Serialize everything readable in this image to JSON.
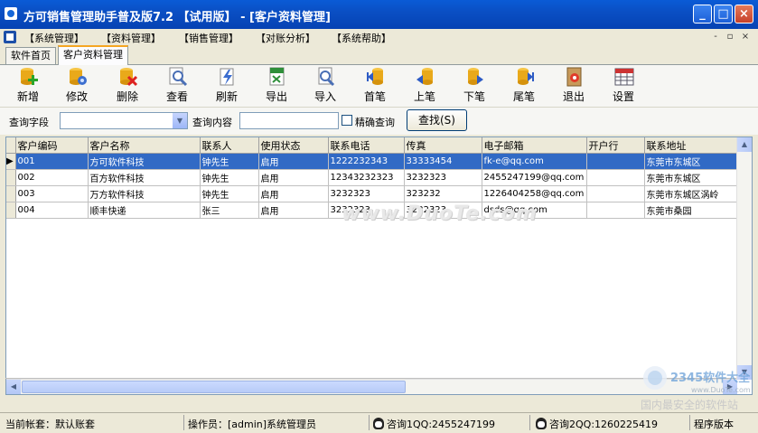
{
  "window": {
    "title": "方可销售管理助手普及版7.2 【试用版】 - [客户资料管理]",
    "controls": [
      "_",
      "□",
      "×"
    ]
  },
  "menu": [
    "【系统管理】",
    "【资料管理】",
    "【销售管理】",
    "【对账分析】",
    "【系统帮助】"
  ],
  "mdi_controls": [
    "-",
    "▫",
    "×"
  ],
  "tabs": [
    "软件首页",
    "客户资料管理"
  ],
  "active_tab": 1,
  "toolbar": [
    {
      "label": "新增",
      "icon": "add-icon"
    },
    {
      "label": "修改",
      "icon": "edit-icon"
    },
    {
      "label": "删除",
      "icon": "delete-icon"
    },
    {
      "label": "查看",
      "icon": "view-icon"
    },
    {
      "label": "刷新",
      "icon": "refresh-icon"
    },
    {
      "label": "导出",
      "icon": "export-icon"
    },
    {
      "label": "导入",
      "icon": "import-icon"
    },
    {
      "label": "首笔",
      "icon": "first-record-icon"
    },
    {
      "label": "上笔",
      "icon": "prev-record-icon"
    },
    {
      "label": "下笔",
      "icon": "next-record-icon"
    },
    {
      "label": "尾笔",
      "icon": "last-record-icon"
    },
    {
      "label": "退出",
      "icon": "exit-icon"
    },
    {
      "label": "设置",
      "icon": "settings-icon"
    }
  ],
  "query": {
    "field_label": "查询字段",
    "field_value": "",
    "content_label": "查询内容",
    "content_value": "",
    "exact_label": "精确查询",
    "exact_checked": false,
    "search_button": "查找(S)"
  },
  "table": {
    "columns": [
      "客户编码",
      "客户名称",
      "联系人",
      "使用状态",
      "联系电话",
      "传真",
      "电子邮箱",
      "开户行",
      "联系地址"
    ],
    "rows": [
      [
        "001",
        "方可软件科技",
        "钟先生",
        "启用",
        "1222232343",
        "33333454",
        "fk-e@qq.com",
        "",
        "东莞市东城区"
      ],
      [
        "002",
        "百方软件科技",
        "钟先生",
        "启用",
        "12343232323",
        "3232323",
        "2455247199@qq.com",
        "",
        "东莞市东城区"
      ],
      [
        "003",
        "万方软件科技",
        "钟先生",
        "启用",
        "3232323",
        "323232",
        "1226404258@qq.com",
        "",
        "东莞市东城区涡岭"
      ],
      [
        "004",
        "顺丰快递",
        "张三",
        "启用",
        "3232323",
        "3232323",
        "dsds@qq.com",
        "",
        "东莞市桑园"
      ]
    ],
    "selected_row": 0
  },
  "watermark": "www.DuoTe.com",
  "status": {
    "account": "当前帐套：默认账套",
    "operator": "操作员：[admin]系统管理员",
    "qq1": "咨询1QQ:2455247199",
    "qq2": "咨询2QQ:1260225419",
    "version": "程序版本"
  },
  "corner_logo": {
    "text": "2345软件大全",
    "sub": "国内最安全的软件站",
    "url": "www.DuoTe.com"
  }
}
